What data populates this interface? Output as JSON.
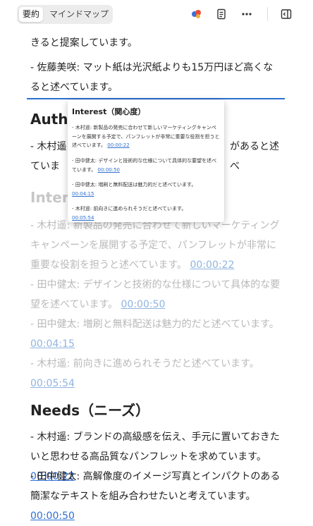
{
  "tabs": {
    "summary": "要約",
    "mindmap": "マインドマップ"
  },
  "toolbar": {
    "icons": [
      "app-logo-icon",
      "document-list-icon",
      "more-icon",
      "collapse-panel-icon"
    ]
  },
  "top_fragment": "きると提案しています。",
  "sato": {
    "text": "- 佐藤美咲: マット紙は光沢紙よりも15万円ほど高くなると述べています。"
  },
  "authority": {
    "title_visible": "Autho",
    "item1_visible": "- 木村遥:",
    "item1_tail": "があると述べ",
    "item1_line2": "ていま"
  },
  "interest": {
    "title": "Interest（関心度）",
    "title_visible": "Intere",
    "items": [
      {
        "text": "- 木村遥: 新製品の発売に合わせて新しいマーケティングキャンペーンを展開する予定で、パンフレットが非常に重要な役割を担うと述べています。",
        "ts": "00:00:22"
      },
      {
        "text": "- 田中健太: デザインと技術的な仕様について具体的な要望を述べています。",
        "ts": "00:00:50"
      },
      {
        "text": "- 田中健太: 増刷と無料配送は魅力的だと述べています。",
        "ts": "00:04:15"
      },
      {
        "text": "- 木村遥: 前向きに進められそうだと述べています。",
        "ts": "00:05:54"
      }
    ]
  },
  "needs": {
    "title": "Needs（ニーズ）",
    "items": [
      {
        "text": "- 木村遥: ブランドの高級感を伝え、手元に置いておきたいと思わせる高品質なパンフレットを求めています。",
        "ts": "00:00:22"
      },
      {
        "text": "- 田中健太: 高解像度のイメージ写真とインパクトのある簡潔なテキストを組み合わせたいと考えています。",
        "ts": "00:00:50"
      }
    ]
  },
  "colors": {
    "accent": "#2b6fce",
    "link": "#2f6fd1"
  }
}
